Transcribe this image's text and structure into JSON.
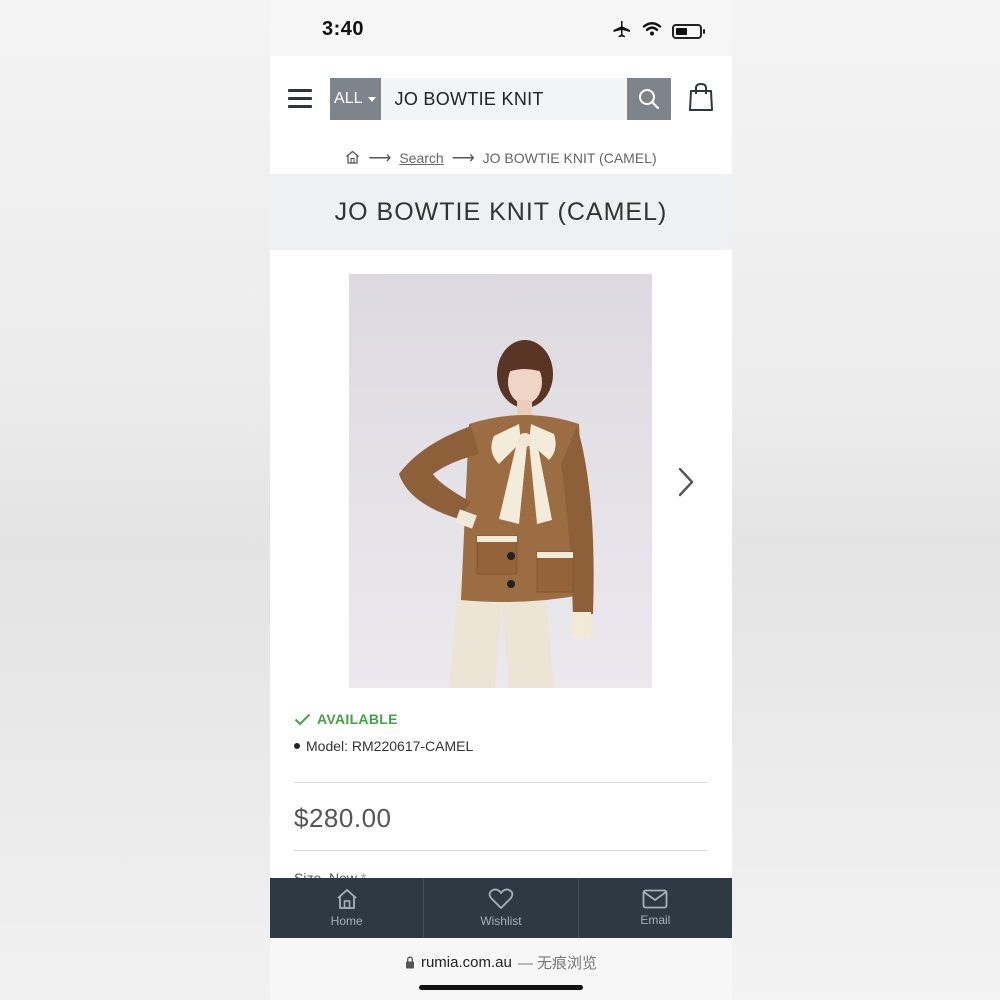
{
  "status_bar": {
    "time": "3:40"
  },
  "header": {
    "category_select": "ALL",
    "search_value": "JO BOWTIE KNIT"
  },
  "breadcrumb": {
    "search_label": "Search",
    "current": "JO BOWTIE KNIT (CAMEL)"
  },
  "product": {
    "title": "JO BOWTIE KNIT (CAMEL)",
    "availability": "AVAILABLE",
    "model": "Model: RM220617-CAMEL",
    "price": "$280.00",
    "size_label": "Size, New",
    "size_required": "*"
  },
  "bottom_nav": {
    "items": [
      {
        "label": "Home",
        "icon": "home-icon"
      },
      {
        "label": "Wishlist",
        "icon": "heart-icon"
      },
      {
        "label": "Email",
        "icon": "envelope-icon"
      }
    ]
  },
  "url_bar": {
    "domain": "rumia.com.au",
    "suffix": "— 无痕浏览"
  },
  "colors": {
    "accent_gray": "#7d848c",
    "available_green": "#43a147",
    "nav_bg": "#2f3944",
    "title_band": "#eef0f3"
  }
}
